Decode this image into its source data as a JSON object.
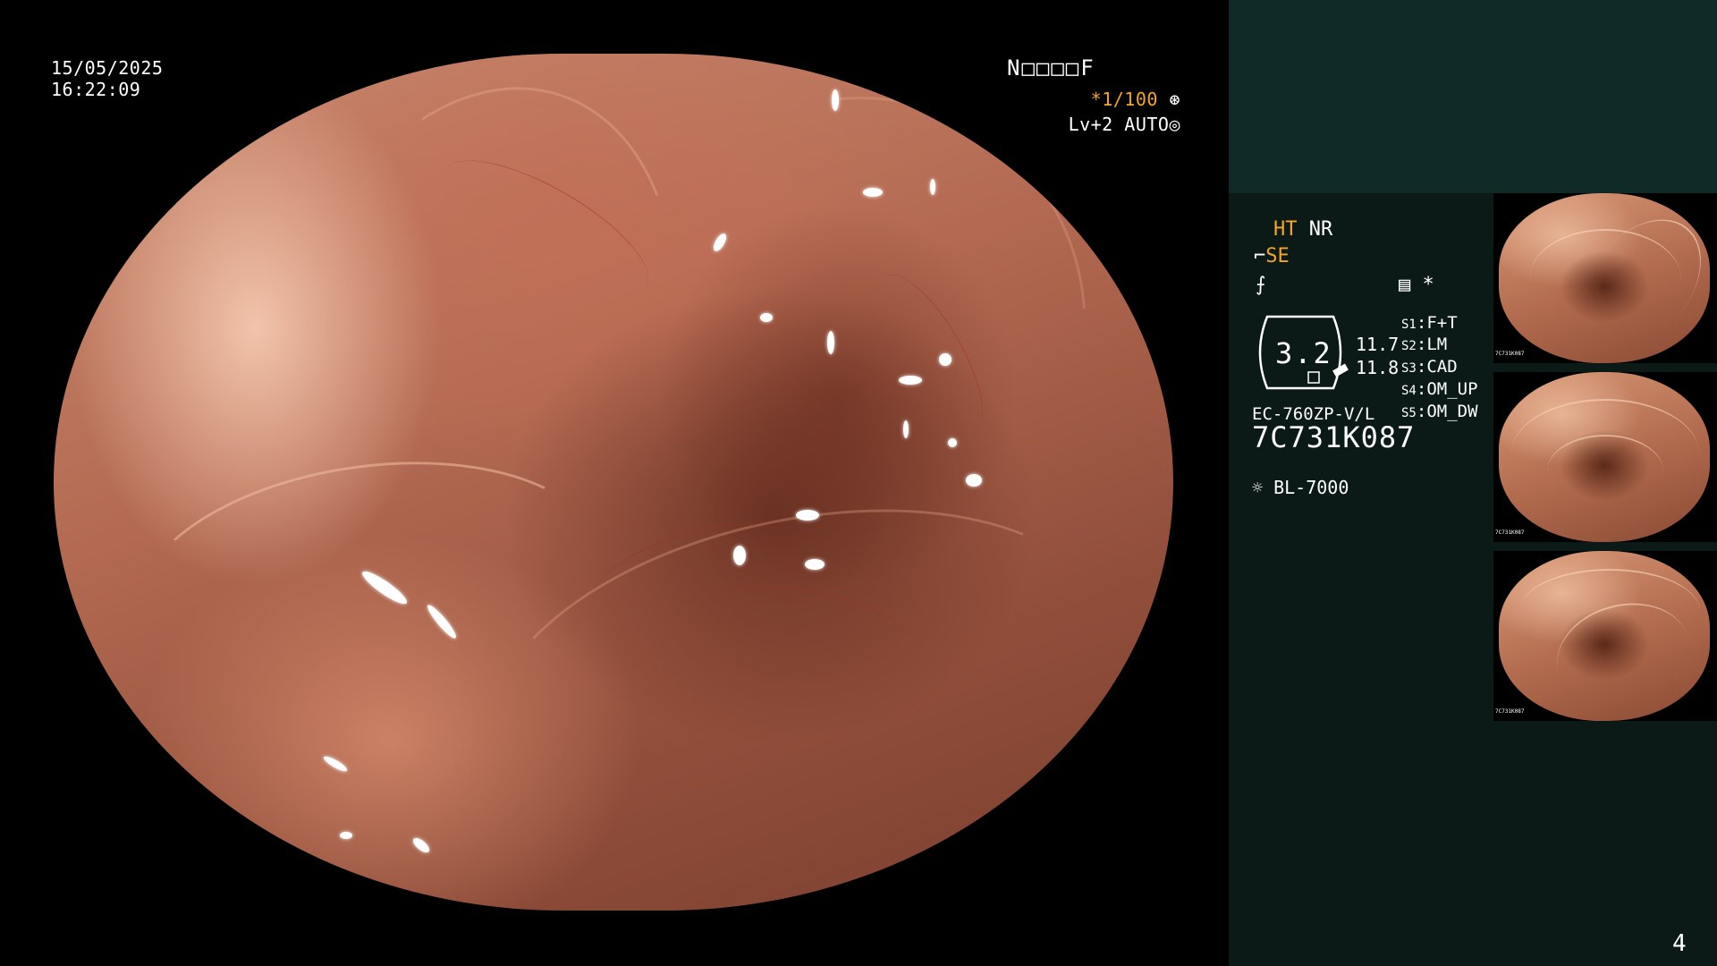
{
  "overlay": {
    "date": "15/05/2025",
    "time": "16:22:09",
    "patient_id": "N□□□□F",
    "shutter": "*1/100",
    "shutter_icon": "shutter-icon",
    "level": "Lv+2",
    "auto": "AUTO",
    "iris_icon": "iris-icon"
  },
  "settings": {
    "ht": "HT",
    "nr": "NR",
    "se_prefix": "ↄ",
    "se": "SE",
    "hand_symbol": "⨍",
    "memo_icon": "memo-icon",
    "asterisk": "*"
  },
  "gauge": {
    "value": "3.2",
    "num_top": "11.7",
    "num_bottom": "11.8"
  },
  "switches": [
    {
      "key": "S1",
      "value": "F+T"
    },
    {
      "key": "S2",
      "value": "LM"
    },
    {
      "key": "S3",
      "value": "CAD"
    },
    {
      "key": "S4",
      "value": "OM_UP"
    },
    {
      "key": "S5",
      "value": "OM_DW"
    }
  ],
  "scope": {
    "model": "EC-760ZP-V/L",
    "serial": "7C731K087"
  },
  "light_source": {
    "icon": "light-source-icon",
    "model": "BL-7000"
  },
  "thumbnails": [
    {
      "label": "thumbnail-1",
      "caption": "7C731K087"
    },
    {
      "label": "thumbnail-2",
      "caption": "7C731K087"
    },
    {
      "label": "thumbnail-3",
      "caption": "7C731K087"
    }
  ],
  "page_number": "4",
  "colors": {
    "accent_orange": "#f5a623",
    "panel_bg": "#0b1a17",
    "panel_top_bg": "#0f2a26"
  }
}
